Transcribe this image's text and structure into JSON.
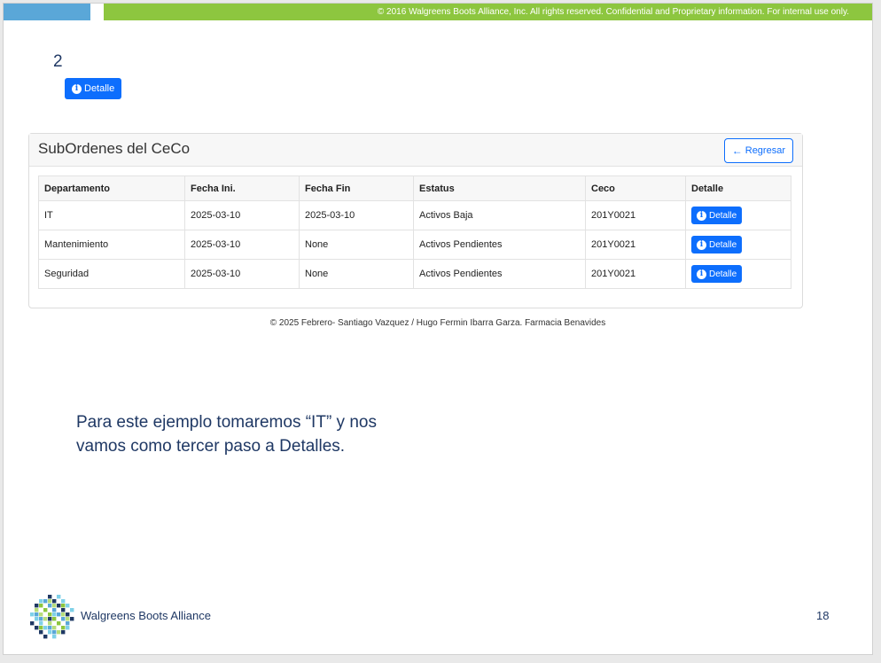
{
  "header": {
    "copyright": "© 2016 Walgreens Boots Alliance, Inc. All rights reserved. Confidential and Proprietary information. For internal use only."
  },
  "step_number": "2",
  "top_button": {
    "icon": "info-icon",
    "label": "Detalle"
  },
  "card": {
    "title": "SubOrdenes del CeCo",
    "back_button": {
      "icon": "arrow-left-icon",
      "label": "Regresar"
    },
    "table": {
      "headers": [
        "Departamento",
        "Fecha Ini.",
        "Fecha Fin",
        "Estatus",
        "Ceco",
        "Detalle"
      ],
      "rows": [
        {
          "departamento": "IT",
          "fecha_ini": "2025-03-10",
          "fecha_fin": "2025-03-10",
          "estatus": "Activos Baja",
          "ceco": "201Y0021",
          "detalle": "Detalle"
        },
        {
          "departamento": "Mantenimiento",
          "fecha_ini": "2025-03-10",
          "fecha_fin": "None",
          "estatus": "Activos Pendientes",
          "ceco": "201Y0021",
          "detalle": "Detalle"
        },
        {
          "departamento": "Seguridad",
          "fecha_ini": "2025-03-10",
          "fecha_fin": "None",
          "estatus": "Activos Pendientes",
          "ceco": "201Y0021",
          "detalle": "Detalle"
        }
      ]
    }
  },
  "footer_credit": "© 2025 Febrero- Santiago Vazquez / Hugo Fermin Ibarra Garza. Farmacia Benavides",
  "caption": "Para este ejemplo tomaremos “IT” y nos vamos como tercer paso a Detalles.",
  "logo": {
    "icon": "walgreens-boots-alliance-logo-icon",
    "text": "Walgreens Boots Alliance"
  },
  "page_number": "18",
  "colors": {
    "primary": "#0d6efd",
    "brand_green": "#8dc63f",
    "brand_blue": "#5aa7d8",
    "navy": "#1f3864"
  }
}
